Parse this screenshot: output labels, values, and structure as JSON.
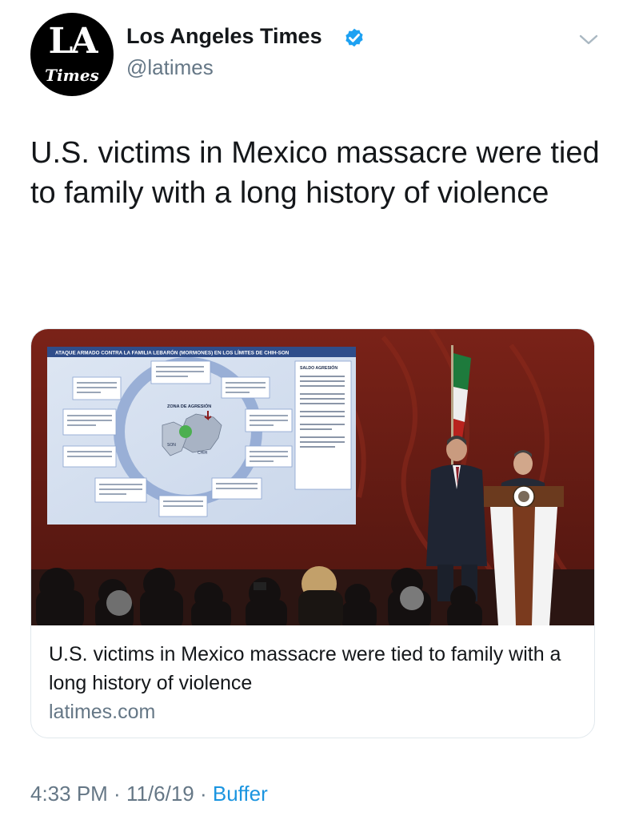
{
  "header": {
    "avatar_la": "LA",
    "avatar_times": "Times",
    "display_name": "Los Angeles Times",
    "handle": "@latimes",
    "verified_icon": "verified-badge-icon",
    "menu_icon": "chevron-down-icon"
  },
  "tweet": {
    "text": "U.S. victims in Mexico massacre were tied to family with a long history of violence"
  },
  "card": {
    "image_icon": "press-conference-photo",
    "slide_title": "ATAQUE ARMADO CONTRA LA FAMILIA LEBARÓN (MORMONES) EN LOS LÍMITES DE CHIH-SON",
    "slide_center_label": "ZONA DE AGRESIÓN",
    "slide_son": "SON",
    "slide_chih": "CHIH",
    "slide_panel_title": "SALDO AGRESIÓN",
    "title": "U.S. victims in Mexico massacre were tied to family with a long history of violence",
    "domain": "latimes.com"
  },
  "meta": {
    "time": "4:33 PM",
    "separator1": " · ",
    "date": "11/6/19",
    "separator2": " · ",
    "source": "Buffer"
  },
  "colors": {
    "text": "#14171a",
    "secondary": "#657786",
    "link": "#1b95e0",
    "verified": "#1da1f2",
    "border": "#e1e8ed"
  }
}
